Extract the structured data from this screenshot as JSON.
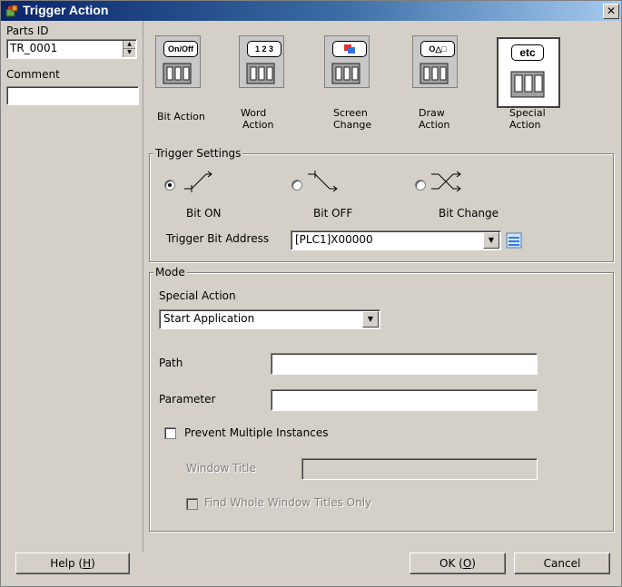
{
  "window": {
    "title": "Trigger Action",
    "close_glyph": "✕"
  },
  "left": {
    "parts_id_label": "Parts ID",
    "parts_id_value": "TR_0001",
    "comment_label": "Comment",
    "comment_value": ""
  },
  "actions": [
    {
      "tag": "On/Off",
      "label1": "Bit Action",
      "label2": "",
      "selected": false
    },
    {
      "tag": "1 2 3",
      "label1": "Word",
      "label2": "Action",
      "selected": false
    },
    {
      "tag": "",
      "label1": "Screen",
      "label2": "Change",
      "selected": false
    },
    {
      "tag": "O△□",
      "label1": "Draw",
      "label2": "Action",
      "selected": false
    },
    {
      "tag": "etc",
      "label1": "Special",
      "label2": "Action",
      "selected": true
    }
  ],
  "trigger": {
    "group_label": "Trigger Settings",
    "options": [
      {
        "label": "Bit ON",
        "checked": true,
        "icon": "bit-on-icon"
      },
      {
        "label": "Bit OFF",
        "checked": false,
        "icon": "bit-off-icon"
      },
      {
        "label": "Bit Change",
        "checked": false,
        "icon": "bit-change-icon"
      }
    ],
    "address_label": "Trigger Bit Address",
    "address_value": "[PLC1]X00000"
  },
  "mode": {
    "group_label": "Mode",
    "special_action_label": "Special Action",
    "special_action_value": "Start Application",
    "path_label": "Path",
    "path_value": "",
    "parameter_label": "Parameter",
    "parameter_value": "",
    "prevent_label": "Prevent Multiple Instances",
    "window_title_label": "Window Title",
    "window_title_value": "",
    "find_whole_label": "Find Whole Window Titles Only"
  },
  "buttons": {
    "help": "Help (",
    "help_key": "H",
    "ok": "OK (",
    "ok_key": "O",
    "close_paren": ")",
    "cancel": "Cancel"
  }
}
